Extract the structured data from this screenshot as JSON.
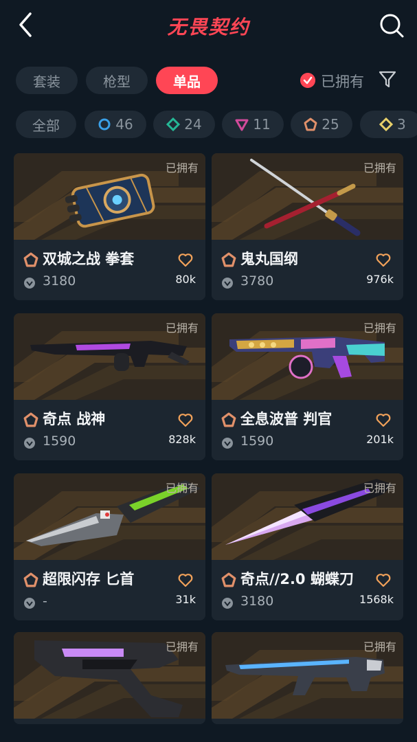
{
  "header": {
    "title": "无畏契约"
  },
  "tabs": [
    {
      "label": "套装"
    },
    {
      "label": "枪型"
    },
    {
      "label": "单品"
    }
  ],
  "owned_filter": {
    "label": "已拥有"
  },
  "tiers": [
    {
      "label": "全部"
    },
    {
      "label": "46",
      "color": "#3aa0e8"
    },
    {
      "label": "24",
      "color": "#25b896"
    },
    {
      "label": "11",
      "color": "#d24a9a"
    },
    {
      "label": "25",
      "color": "#e0906a"
    },
    {
      "label": "3",
      "color": "#e8d06a"
    }
  ],
  "items": [
    {
      "name": "双城之战 拳套",
      "price": "3180",
      "likes": "80k",
      "owned": "已拥有"
    },
    {
      "name": "鬼丸国纲",
      "price": "3780",
      "likes": "976k",
      "owned": "已拥有"
    },
    {
      "name": "奇点 战神",
      "price": "1590",
      "likes": "828k",
      "owned": "已拥有"
    },
    {
      "name": "全息波普 判官",
      "price": "1590",
      "likes": "201k",
      "owned": "已拥有"
    },
    {
      "name": "超限闪存 匕首",
      "price": "-",
      "likes": "31k",
      "owned": "已拥有"
    },
    {
      "name": "奇点//2.0 蝴蝶刀",
      "price": "3180",
      "likes": "1568k",
      "owned": "已拥有"
    },
    {
      "owned": "已拥有"
    },
    {
      "owned": "已拥有"
    }
  ]
}
